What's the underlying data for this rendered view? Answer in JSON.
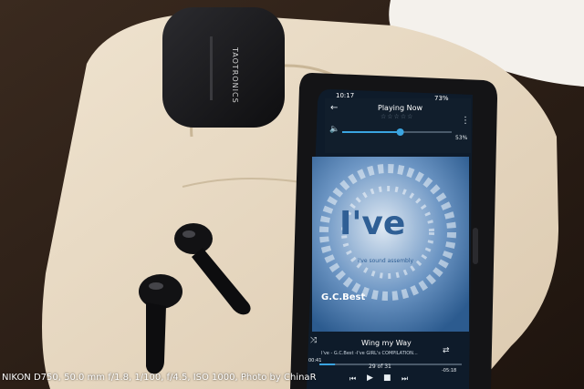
{
  "photo": {
    "caption": "NIKON D750, 50.0 mm f/1.8, 1/100, f/4.5, ISO 1000, Photo by ChinaR",
    "earbud_case_brand": "TAOTRONICS"
  },
  "phone": {
    "status_bar": {
      "time": "10:17",
      "battery": "73%"
    },
    "header": {
      "title": "Playing Now",
      "rating_stars": 5,
      "rating_filled": 0
    },
    "volume": {
      "percent_label": "53%",
      "level": 0.53
    },
    "album_art": {
      "logo": "I've",
      "subtitle": "i've sound assembly",
      "album_tag": "G.C.Best"
    },
    "track": {
      "title": "Wing my Way",
      "artist_album": "I've - G.C.Best -I've GIRL's COMPILATION...",
      "position_label": "29 of 31",
      "elapsed": "00:41",
      "remaining": "-05:18",
      "progress": 0.11
    },
    "colors": {
      "accent": "#3aa4e0",
      "screen_bg": "#0e1b2a",
      "art_blue": "#3d73a8"
    }
  }
}
